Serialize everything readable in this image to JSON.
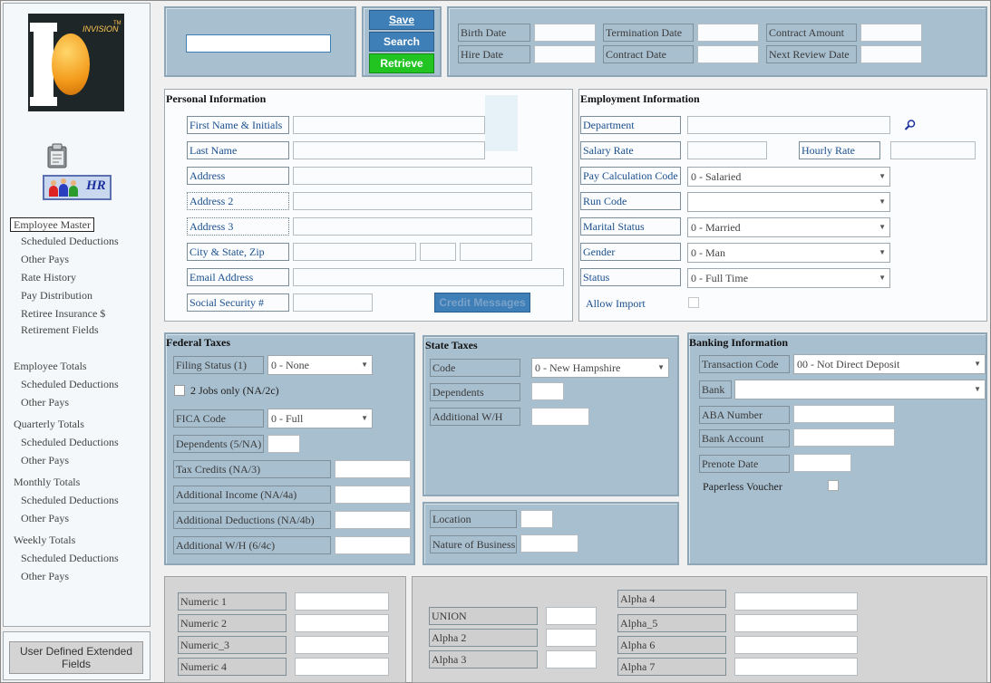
{
  "toolbar": {
    "save_label": "Save",
    "search_label": "Search",
    "retrieve_label": "Retrieve",
    "search_value": ""
  },
  "dates": {
    "birth_date": "Birth Date",
    "hire_date": "Hire Date",
    "termination_date": "Termination Date",
    "contract_date": "Contract Date",
    "contract_amount": "Contract Amount",
    "next_review_date": "Next Review Date"
  },
  "logo": {
    "brand": "INVISION",
    "tm": "TM",
    "hr_badge": "HR"
  },
  "sidebar": {
    "employee_master": "Employee Master",
    "items_master": [
      "Scheduled Deductions",
      "Other Pays",
      "Rate History",
      "Pay Distribution",
      "Retiree Insurance $",
      "Retirement Fields"
    ],
    "employee_totals": "Employee Totals",
    "employee_totals_items": [
      "Scheduled Deductions",
      "Other Pays"
    ],
    "quarterly_totals": "Quarterly Totals",
    "quarterly_items": [
      "Scheduled Deductions",
      "Other Pays"
    ],
    "monthly_totals": "Monthly Totals",
    "monthly_items": [
      "Scheduled Deductions",
      "Other Pays"
    ],
    "weekly_totals": "Weekly Totals",
    "weekly_items": [
      "Scheduled Deductions",
      "Other Pays"
    ],
    "user_defined_button": "User Defined Extended Fields"
  },
  "personal": {
    "title": "Personal Information",
    "first_name": "First Name & Initials",
    "last_name": "Last Name",
    "address": "Address",
    "address2": "Address 2",
    "address3": "Address 3",
    "city_state_zip": "City & State, Zip",
    "email": "Email Address",
    "ssn": "Social Security #",
    "credit_messages": "Credit Messages"
  },
  "employment": {
    "title": "Employment Information",
    "department": "Department",
    "salary_rate": "Salary Rate",
    "hourly_rate": "Hourly Rate",
    "pay_calc_code": "Pay Calculation Code",
    "pay_calc_value": "0 - Salaried",
    "run_code": "Run Code",
    "run_code_value": "",
    "marital_status": "Marital Status",
    "marital_value": "0 - Married",
    "gender": "Gender",
    "gender_value": "0 - Man",
    "status": "Status",
    "status_value": "0 - Full Time",
    "allow_import": "Allow Import"
  },
  "federal": {
    "title": "Federal Taxes",
    "filing_status": "Filing Status (1)",
    "filing_value": "0 - None",
    "two_jobs": "2 Jobs only (NA/2c)",
    "fica_code": "FICA Code",
    "fica_value": "0 - Full",
    "dependents": "Dependents (5/NA)",
    "tax_credits": "Tax Credits (NA/3)",
    "additional_income": "Additional Income (NA/4a)",
    "additional_deductions": "Additional Deductions (NA/4b)",
    "additional_wh": "Additional W/H (6/4c)"
  },
  "state": {
    "title": "State Taxes",
    "code": "Code",
    "code_value": "0 - New Hampshire",
    "dependents": "Dependents",
    "additional_wh": "Additional W/H",
    "location": "Location",
    "nature_of_business": "Nature of Business"
  },
  "banking": {
    "title": "Banking Information",
    "transaction_code": "Transaction Code",
    "transaction_value": "00 - Not Direct Deposit",
    "bank": "Bank",
    "bank_value": "",
    "aba_number": "ABA Number",
    "bank_account": "Bank Account",
    "prenote_date": "Prenote Date",
    "paperless_voucher": "Paperless Voucher"
  },
  "userdef": {
    "numeric": [
      "Numeric 1",
      "Numeric 2",
      "Numeric_3",
      "Numeric 4"
    ],
    "union": "UNION",
    "alpha_left": [
      "Alpha 2",
      "Alpha 3"
    ],
    "alpha_right": [
      "Alpha 4",
      "Alpha_5",
      "Alpha 6",
      "Alpha 7"
    ]
  },
  "colors": {
    "panel_blue": "#a8bfcf",
    "button_blue": "#3f7fb8",
    "retrieve_green": "#22c422",
    "link_blue": "#1b4f8e"
  }
}
